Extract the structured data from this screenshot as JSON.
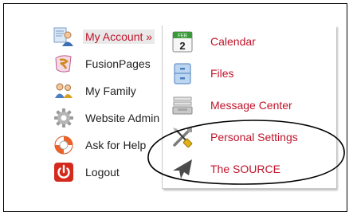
{
  "menu": {
    "items": [
      {
        "label": "My Account »",
        "icon": "person-account-icon",
        "active": true
      },
      {
        "label": "FusionPages",
        "icon": "fusionpages-logo-icon"
      },
      {
        "label": "My Family",
        "icon": "family-people-icon"
      },
      {
        "label": "Website Admin",
        "icon": "gear-icon"
      },
      {
        "label": "Ask for Help",
        "icon": "lifebuoy-icon"
      },
      {
        "label": "Logout",
        "icon": "power-icon"
      }
    ]
  },
  "submenu": {
    "items": [
      {
        "label": "Calendar",
        "icon": "calendar-icon",
        "calendar_header": "FEB",
        "calendar_day": "2"
      },
      {
        "label": "Files",
        "icon": "file-cabinet-icon"
      },
      {
        "label": "Message Center",
        "icon": "inbox-tray-icon"
      },
      {
        "label": "Personal Settings",
        "icon": "tools-icon"
      },
      {
        "label": "The SOURCE",
        "icon": "jet-icon"
      }
    ]
  },
  "colors": {
    "accent": "#c0132a",
    "active_bg": "#e9e9e9",
    "annotation": "#000000"
  }
}
